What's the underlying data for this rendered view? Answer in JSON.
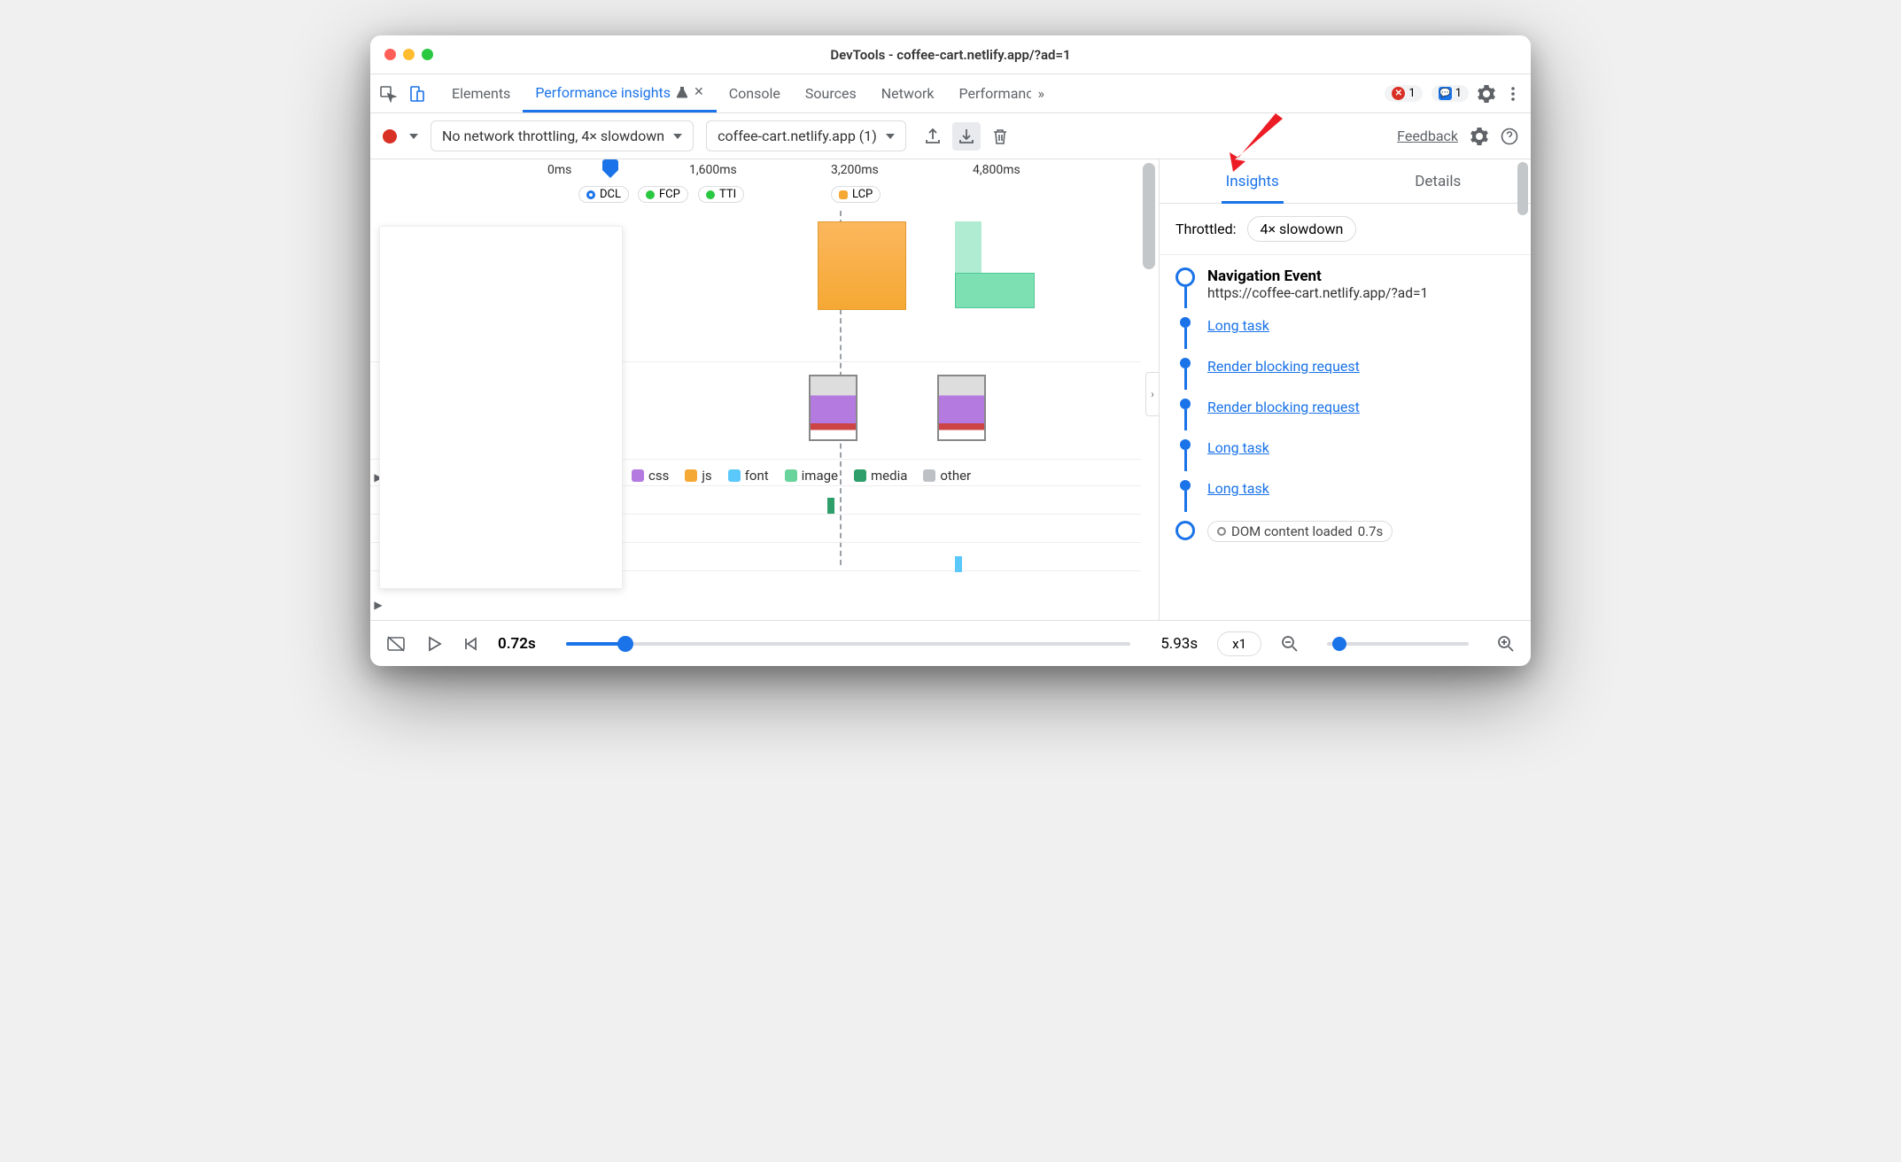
{
  "window": {
    "title": "DevTools - coffee-cart.netlify.app/?ad=1"
  },
  "tabs": {
    "items": [
      "Elements",
      "Performance insights",
      "Console",
      "Sources",
      "Network",
      "Performance"
    ],
    "active": "Performance insights",
    "overflow": "»",
    "error_count": "1",
    "message_count": "1"
  },
  "toolbar": {
    "throttle_select": "No network throttling, 4× slowdown",
    "recording_select": "coffee-cart.netlify.app (1)",
    "feedback": "Feedback"
  },
  "timeline": {
    "ticks": [
      "0ms",
      "1,600ms",
      "3,200ms",
      "4,800ms"
    ],
    "markers": {
      "dcl": "DCL",
      "fcp": "FCP",
      "tti": "TTI",
      "lcp": "LCP"
    },
    "legend": {
      "css": "css",
      "js": "js",
      "font": "font",
      "image": "image",
      "media": "media",
      "other": "other"
    }
  },
  "sidepanel": {
    "tabs": {
      "insights": "Insights",
      "details": "Details"
    },
    "throttled_label": "Throttled:",
    "throttled_value": "4× slowdown",
    "nav_event": {
      "title": "Navigation Event",
      "url": "https://coffee-cart.netlify.app/?ad=1"
    },
    "insights": [
      "Long task",
      "Render blocking request",
      "Render blocking request",
      "Long task",
      "Long task"
    ],
    "dcl_event": "DOM content loaded",
    "dcl_time": "0.7s"
  },
  "footer": {
    "start_time": "0.72s",
    "end_time": "5.93s",
    "speed": "x1"
  },
  "colors": {
    "css": "#b47ae0",
    "js": "#f5a833",
    "font": "#5ac8fa",
    "image": "#68d39a",
    "media": "#2e9e6a",
    "other": "#bdc1c6"
  }
}
